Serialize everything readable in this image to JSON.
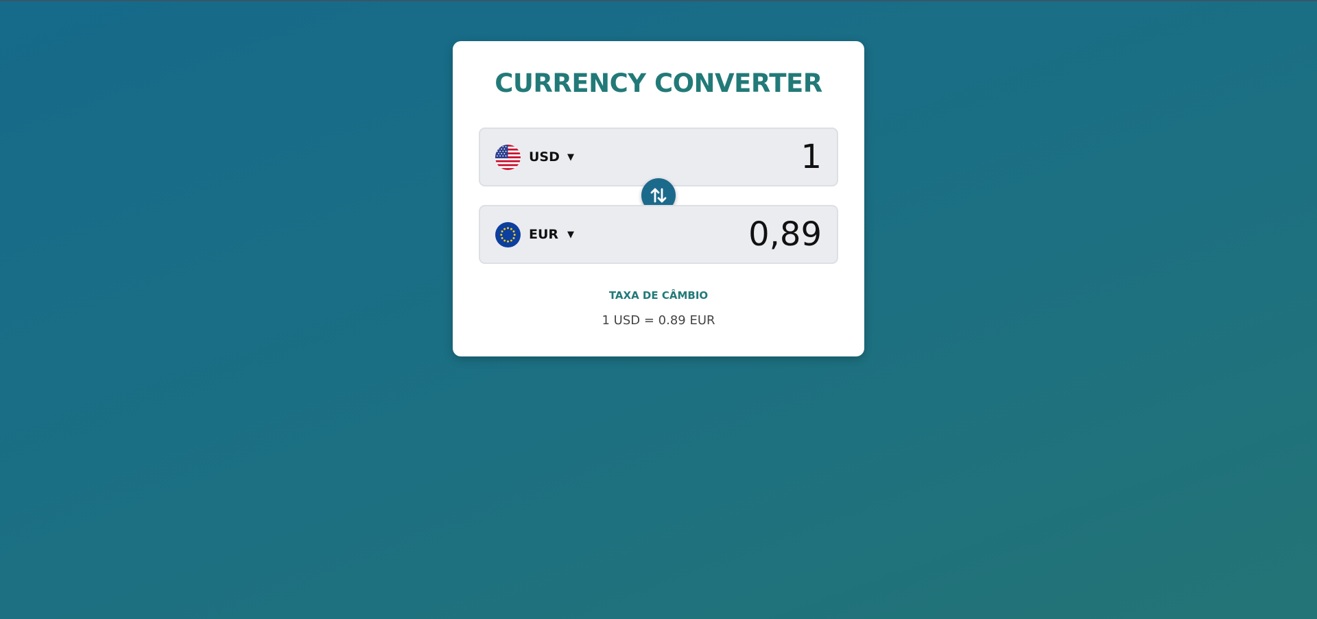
{
  "app": {
    "title": "CURRENCY CONVERTER"
  },
  "from": {
    "code": "USD",
    "flag": "us-flag-icon",
    "dropdown_icon": "triangle-down-icon",
    "amount": "1"
  },
  "to": {
    "code": "EUR",
    "flag": "eu-flag-icon",
    "dropdown_icon": "triangle-down-icon",
    "amount": "0,89"
  },
  "swap": {
    "icon": "swap-vertical-icon"
  },
  "rate": {
    "label": "TAXA DE CÂMBIO",
    "text": "1 USD = 0.89 EUR"
  },
  "colors": {
    "accent": "#227a78",
    "swap_button": "#1c6a8b",
    "field_background": "#ebecf0",
    "background_start": "#166a8a",
    "background_end": "#237476"
  }
}
